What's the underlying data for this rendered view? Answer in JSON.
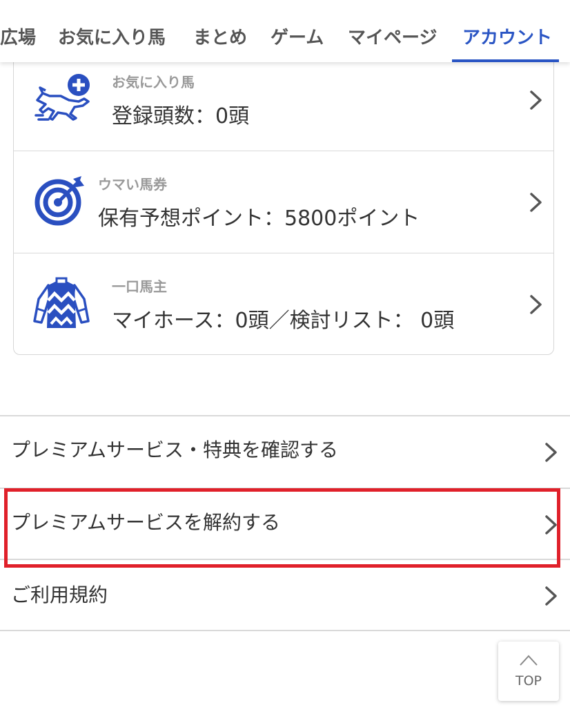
{
  "tabs": [
    {
      "label": "広場",
      "active": false
    },
    {
      "label": "お気に入り馬",
      "active": false
    },
    {
      "label": "まとめ",
      "active": false
    },
    {
      "label": "ゲーム",
      "active": false
    },
    {
      "label": "マイページ",
      "active": false
    },
    {
      "label": "アカウント",
      "active": true
    }
  ],
  "card": {
    "rows": [
      {
        "icon": "horse-add-icon",
        "caption": "お気に入り馬",
        "value": "登録頭数：0頭"
      },
      {
        "icon": "target-icon",
        "caption": "ウマい馬券",
        "value": "保有予想ポイント：5800ポイント"
      },
      {
        "icon": "jockey-silks-icon",
        "caption": "一口馬主",
        "value": "マイホース：0頭／検討リスト： 0頭"
      }
    ]
  },
  "menu": {
    "items": [
      {
        "label": "プレミアムサービス・特典を確認する"
      },
      {
        "label": "プレミアムサービスを解約する",
        "highlighted": true
      },
      {
        "label": "ご利用規約"
      }
    ]
  },
  "top_button": {
    "label": "TOP",
    "icon": "chevron-up-icon"
  },
  "colors": {
    "accent": "#2a55c4",
    "highlight": "#e0202a",
    "icon_blue": "#2a4fc0",
    "caption_gray": "#999999"
  }
}
